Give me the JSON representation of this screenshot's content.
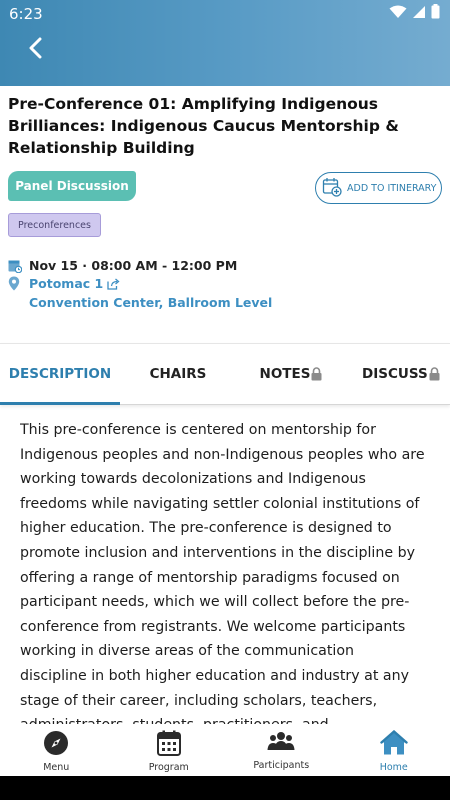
{
  "status_bar": {
    "time": "6:23"
  },
  "session": {
    "title": "Pre-Conference 01: Amplifying Indigenous Brilliances: Indigenous Caucus Mentorship & Relationship Building",
    "type_label": "Panel Discussion",
    "add_itinerary_label": "ADD TO ITINERARY",
    "tag": "Preconferences",
    "datetime": "Nov 15 · 08:00 AM - 12:00 PM",
    "room": "Potomac 1",
    "venue": "Convention Center, Ballroom Level"
  },
  "tabs": [
    {
      "label": "DESCRIPTION",
      "active": true,
      "locked": false
    },
    {
      "label": "CHAIRS",
      "active": false,
      "locked": false
    },
    {
      "label": "NOTES",
      "active": false,
      "locked": true
    },
    {
      "label": "DISCUSS",
      "active": false,
      "locked": true
    }
  ],
  "description": "This pre-conference is centered on mentorship for Indigenous peoples and non-Indigenous peoples who are working towards decolonizations and Indigenous freedoms while navigating settler colonial institutions of higher education. The pre-conference is designed to promote inclusion and interventions in the discipline by offering a range of mentorship paradigms focused on participant needs, which we will collect before the pre-conference from registrants. We welcome participants working in diverse areas of the communication discipline in both higher education and industry at any stage of their career, including scholars, teachers, administrators, students, practitioners, and",
  "bottom_nav": [
    {
      "label": "Menu",
      "icon": "compass-icon",
      "active": false
    },
    {
      "label": "Program",
      "icon": "calendar-icon",
      "active": false
    },
    {
      "label": "Participants",
      "icon": "people-icon",
      "active": false
    },
    {
      "label": "Home",
      "icon": "home-icon",
      "active": true
    }
  ],
  "colors": {
    "accent": "#2e7fae",
    "link": "#3d8fc2",
    "panel_pill": "#5bbfb3",
    "tag_bg": "#cfc8ef"
  }
}
